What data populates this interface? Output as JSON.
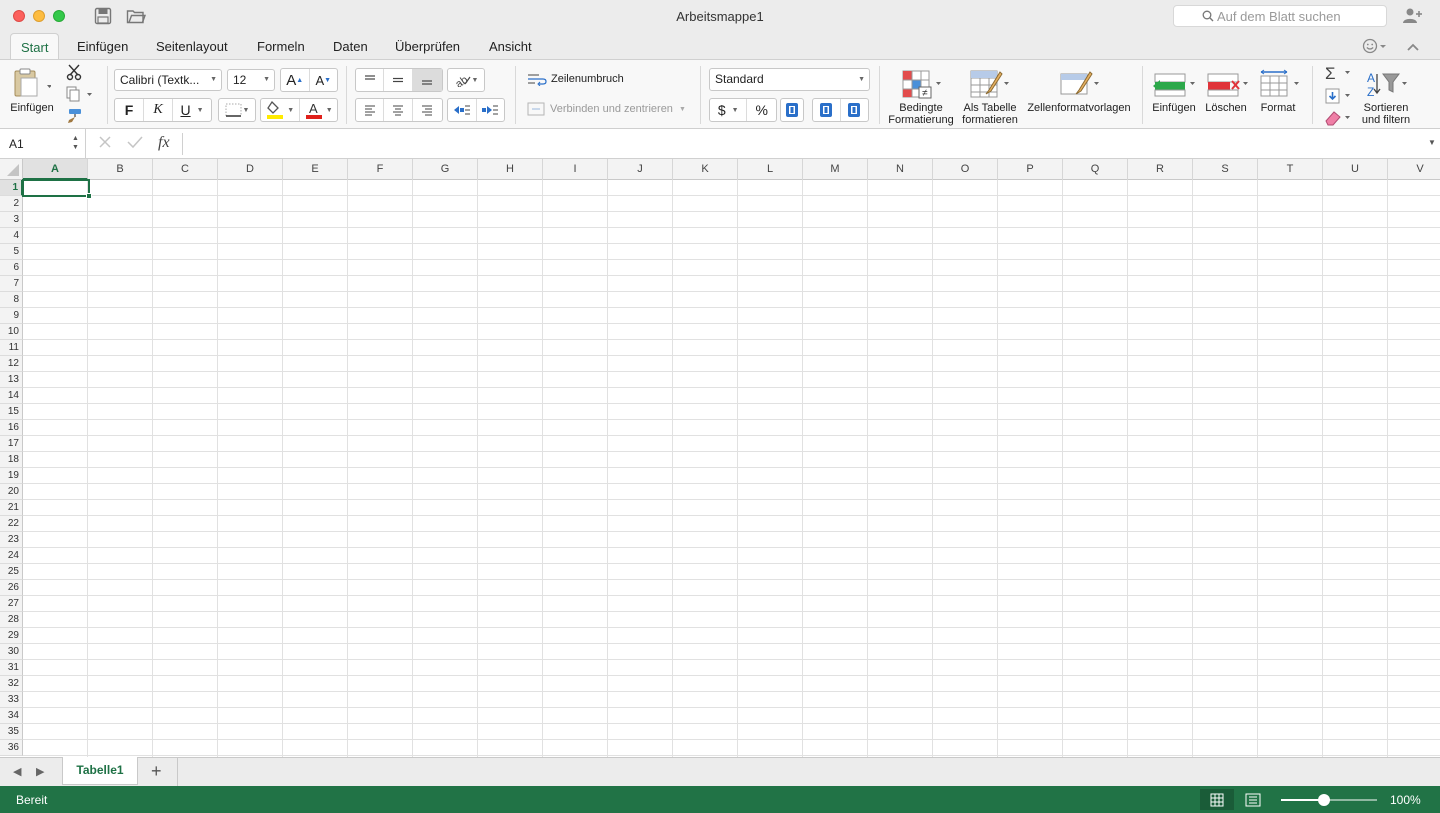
{
  "window": {
    "title": "Arbeitsmappe1",
    "search_placeholder": "Auf dem Blatt suchen"
  },
  "tabs": [
    "Start",
    "Einfügen",
    "Seitenlayout",
    "Formeln",
    "Daten",
    "Überprüfen",
    "Ansicht"
  ],
  "active_tab": "Start",
  "ribbon": {
    "paste_label": "Einfügen",
    "font_name": "Calibri (Textk...",
    "font_size": "12",
    "bold_label": "F",
    "italic_label": "K",
    "underline_label": "U",
    "wrap_text_label": "Zeilenumbruch",
    "merge_label": "Verbinden und zentrieren",
    "number_format": "Standard",
    "currency_label": "$",
    "percent_label": "%",
    "conditional_label_1": "Bedingte",
    "conditional_label_2": "Formatierung",
    "as_table_label_1": "Als Tabelle",
    "as_table_label_2": "formatieren",
    "cell_styles_label": "Zellenformatvorlagen",
    "insert_cells_label": "Einfügen",
    "delete_cells_label": "Löschen",
    "format_label": "Format",
    "sort_label_1": "Sortieren",
    "sort_label_2": "und filtern",
    "accent_color": "#217346"
  },
  "formula_bar": {
    "name_box": "A1",
    "fx_label": "fx",
    "formula": ""
  },
  "grid": {
    "columns": [
      "A",
      "B",
      "C",
      "D",
      "E",
      "F",
      "G",
      "H",
      "I",
      "J",
      "K",
      "L",
      "M",
      "N",
      "O",
      "P",
      "Q",
      "R",
      "S",
      "T",
      "U",
      "V"
    ],
    "rows": [
      "1",
      "2",
      "3",
      "4",
      "5",
      "6",
      "7",
      "8",
      "9",
      "10",
      "11",
      "12",
      "13",
      "14",
      "15",
      "16",
      "17",
      "18",
      "19",
      "20",
      "21",
      "22",
      "23",
      "24",
      "25",
      "26",
      "27",
      "28",
      "29",
      "30",
      "31",
      "32",
      "33",
      "34",
      "35",
      "36"
    ],
    "active_cell": "A1"
  },
  "sheets": {
    "tabs": [
      "Tabelle1"
    ],
    "add_label": "+"
  },
  "status": {
    "text": "Bereit",
    "zoom": "100%",
    "zoom_fraction": 0.45
  }
}
